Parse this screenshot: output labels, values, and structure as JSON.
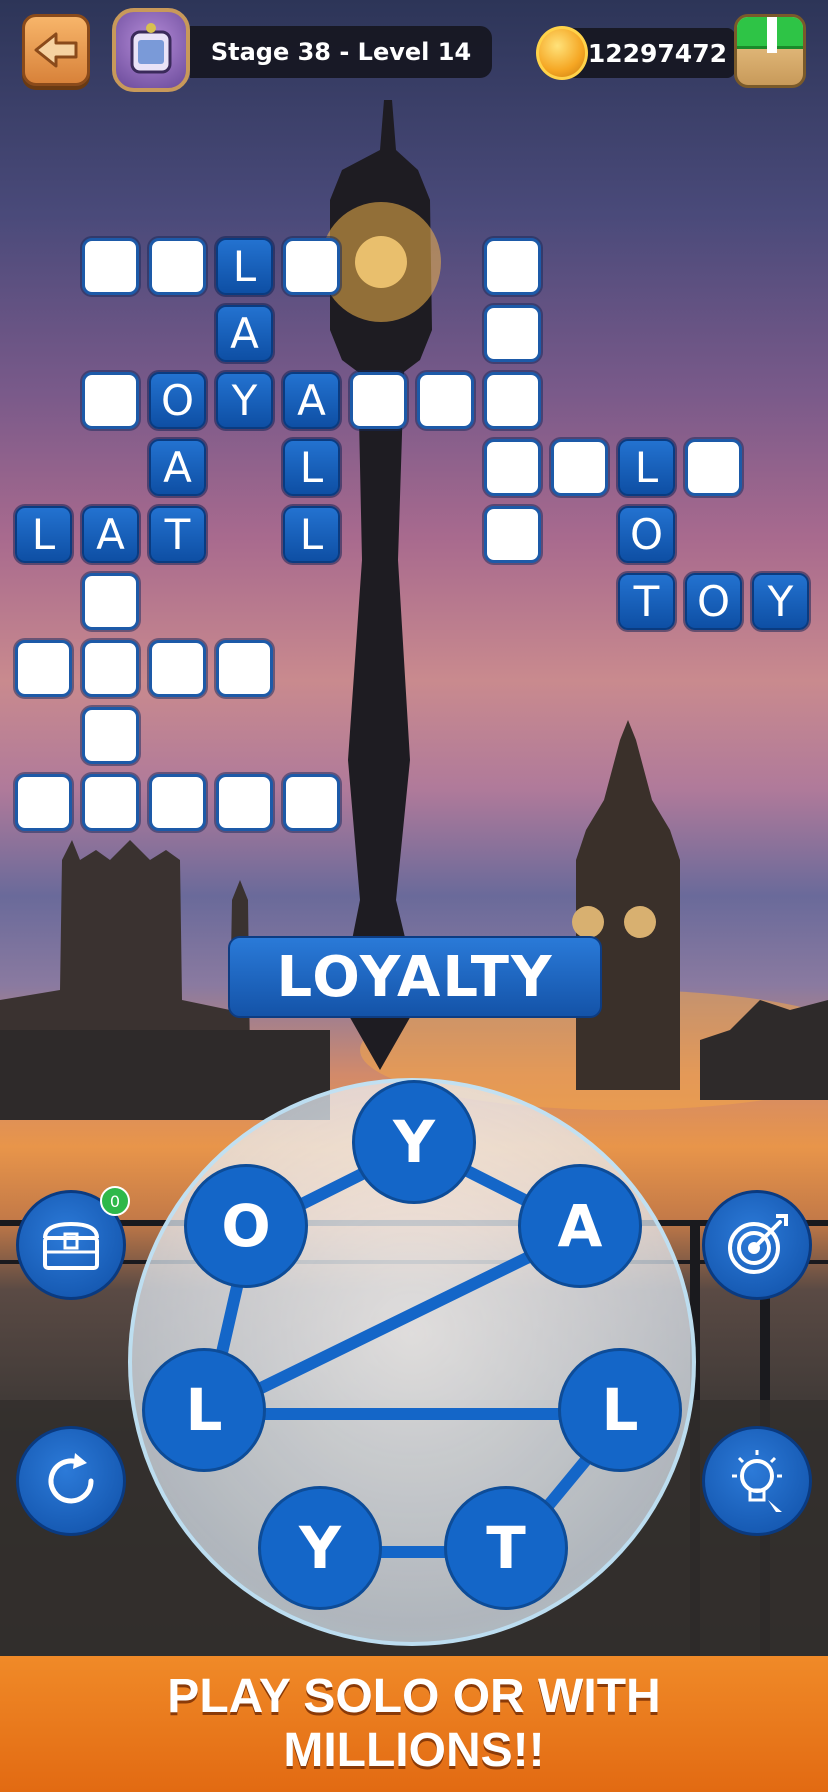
{
  "header": {
    "stage_label": "Stage 38 - Level 14",
    "coins": "12297472"
  },
  "board": {
    "tiles": [
      {
        "col": 0,
        "row": 0,
        "letter": ""
      },
      {
        "col": 1,
        "row": 0,
        "letter": ""
      },
      {
        "col": 2,
        "row": 0,
        "letter": "L"
      },
      {
        "col": 3,
        "row": 0,
        "letter": ""
      },
      {
        "col": 2,
        "row": 1,
        "letter": "A"
      },
      {
        "col": 0,
        "row": 2,
        "letter": ""
      },
      {
        "col": 1,
        "row": 2,
        "letter": "O"
      },
      {
        "col": 2,
        "row": 2,
        "letter": "Y"
      },
      {
        "col": 3,
        "row": 2,
        "letter": "A"
      },
      {
        "col": 4,
        "row": 2,
        "letter": ""
      },
      {
        "col": 5,
        "row": 2,
        "letter": ""
      },
      {
        "col": 6,
        "row": 2,
        "letter": ""
      },
      {
        "col": 1,
        "row": 3,
        "letter": "A"
      },
      {
        "col": 3,
        "row": 3,
        "letter": "L"
      },
      {
        "col": -1,
        "row": 4,
        "letter": "L"
      },
      {
        "col": 0,
        "row": 4,
        "letter": "A"
      },
      {
        "col": 1,
        "row": 4,
        "letter": "T"
      },
      {
        "col": 3,
        "row": 4,
        "letter": "L"
      },
      {
        "col": 6,
        "row": 0,
        "letter": ""
      },
      {
        "col": 6,
        "row": 1,
        "letter": ""
      },
      {
        "col": 6,
        "row": 3,
        "letter": ""
      },
      {
        "col": 7,
        "row": 3,
        "letter": ""
      },
      {
        "col": 8,
        "row": 3,
        "letter": "L"
      },
      {
        "col": 9,
        "row": 3,
        "letter": ""
      },
      {
        "col": 6,
        "row": 4,
        "letter": ""
      },
      {
        "col": 8,
        "row": 4,
        "letter": "O"
      },
      {
        "col": 8,
        "row": 5,
        "letter": "T"
      },
      {
        "col": 9,
        "row": 5,
        "letter": "O"
      },
      {
        "col": 10,
        "row": 5,
        "letter": "Y"
      },
      {
        "col": 0,
        "row": 5,
        "letter": ""
      },
      {
        "col": -1,
        "row": 6,
        "letter": ""
      },
      {
        "col": 0,
        "row": 6,
        "letter": ""
      },
      {
        "col": 1,
        "row": 6,
        "letter": ""
      },
      {
        "col": 2,
        "row": 6,
        "letter": ""
      },
      {
        "col": 0,
        "row": 7,
        "letter": ""
      },
      {
        "col": -1,
        "row": 8,
        "letter": ""
      },
      {
        "col": 0,
        "row": 8,
        "letter": ""
      },
      {
        "col": 1,
        "row": 8,
        "letter": ""
      },
      {
        "col": 2,
        "row": 8,
        "letter": ""
      },
      {
        "col": 3,
        "row": 8,
        "letter": ""
      }
    ]
  },
  "current_word": "LOYALTY",
  "wheel": {
    "letters": [
      {
        "id": "y-top",
        "char": "Y"
      },
      {
        "id": "a",
        "char": "A"
      },
      {
        "id": "l-right",
        "char": "L"
      },
      {
        "id": "t",
        "char": "T"
      },
      {
        "id": "y-bottom",
        "char": "Y"
      },
      {
        "id": "l-left",
        "char": "L"
      },
      {
        "id": "o",
        "char": "O"
      }
    ],
    "path_order": [
      "l-left",
      "o",
      "y-top",
      "a",
      "l-left",
      "l-right",
      "t",
      "y-bottom"
    ]
  },
  "tools": {
    "chest_count": "0"
  },
  "banner": {
    "line1": "PLAY SOLO OR WITH",
    "line2": "MILLIONS!!"
  },
  "colors": {
    "tile_blue": "#1466c8",
    "banner_orange": "#e26a12",
    "coin_gold": "#f5a623"
  }
}
